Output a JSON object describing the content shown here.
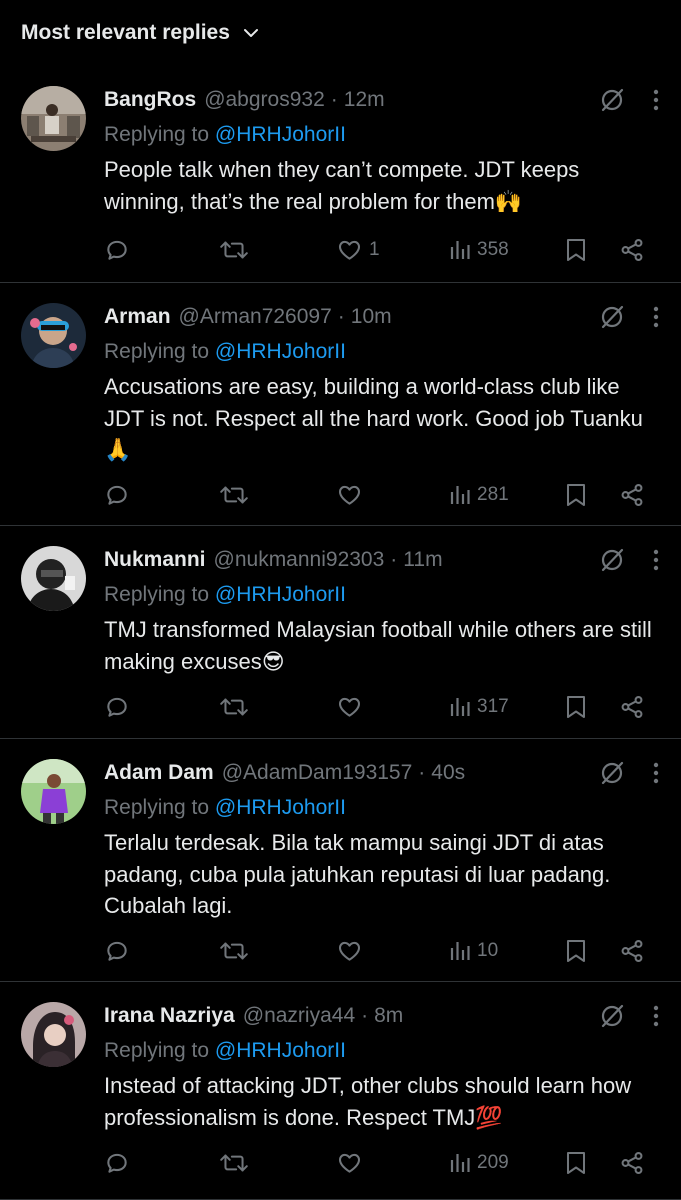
{
  "sort": {
    "label": "Most relevant replies"
  },
  "replies": [
    {
      "name": "BangRos",
      "handle": "@abgros932",
      "time": "12m",
      "replying_prefix": "Replying to",
      "mention": "@HRHJohorII",
      "text": "People talk when they can’t compete. JDT keeps winning, that’s the real problem for them🙌",
      "likes": "1",
      "views": "358"
    },
    {
      "name": "Arman",
      "handle": "@Arman726097",
      "time": "10m",
      "replying_prefix": "Replying to",
      "mention": "@HRHJohorII",
      "text": "Accusations are easy, building a world-class club like JDT is not. Respect all the hard work. Good job Tuanku🙏",
      "likes": "",
      "views": "281"
    },
    {
      "name": "Nukmanni",
      "handle": "@nukmanni92303",
      "time": "11m",
      "replying_prefix": "Replying to",
      "mention": "@HRHJohorII",
      "text": "TMJ transformed Malaysian football while others are still making excuses😎",
      "likes": "",
      "views": "317"
    },
    {
      "name": "Adam Dam",
      "handle": "@AdamDam193157",
      "time": "40s",
      "replying_prefix": "Replying to",
      "mention": "@HRHJohorII",
      "text": "Terlalu terdesak. Bila tak mampu saingi JDT di atas padang, cuba pula jatuhkan reputasi di luar padang. Cubalah lagi.",
      "likes": "",
      "views": "10"
    },
    {
      "name": "Irana Nazriya",
      "handle": "@nazriya44",
      "time": "8m",
      "replying_prefix": "Replying to",
      "mention": "@HRHJohorII",
      "text": "Instead of attacking JDT, other clubs should learn how professionalism is done. Respect TMJ💯",
      "likes": "",
      "views": "209"
    }
  ],
  "icons": {
    "sort": "chevron-down-icon",
    "header": [
      "grok-icon",
      "more-icon"
    ],
    "actions": [
      "reply-icon",
      "repost-icon",
      "like-icon",
      "views-icon",
      "bookmark-icon",
      "share-icon"
    ]
  },
  "colors": {
    "background": "#000000",
    "text": "#e7e9ea",
    "muted": "#71767b",
    "link": "#1d9bf0",
    "divider": "#2f3336"
  }
}
